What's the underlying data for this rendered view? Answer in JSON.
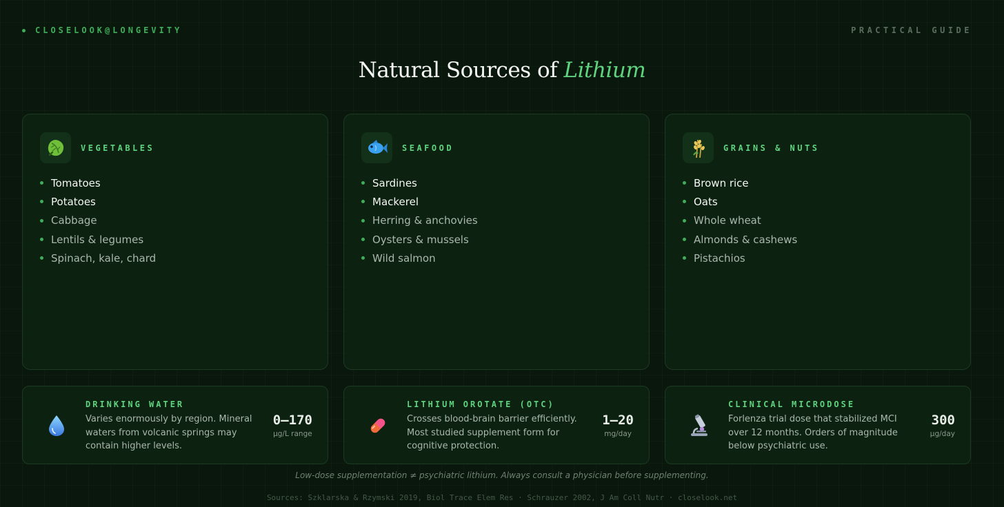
{
  "header": {
    "brand": "CLOSELOOK@LONGEVITY",
    "tag": "PRACTICAL GUIDE"
  },
  "title": {
    "prefix": "Natural Sources of",
    "accent": "Lithium"
  },
  "colors": {
    "accent": "#5fd37f",
    "background": "#0a170c",
    "card": "#0e2612"
  },
  "categories": [
    {
      "title": "VEGETABLES",
      "icon": "leafy-green-icon",
      "items": [
        "Tomatoes",
        "Potatoes",
        "Cabbage",
        "Lentils & legumes",
        "Spinach, kale, chard"
      ]
    },
    {
      "title": "SEAFOOD",
      "icon": "fish-icon",
      "items": [
        "Sardines",
        "Mackerel",
        "Herring & anchovies",
        "Oysters & mussels",
        "Wild salmon"
      ]
    },
    {
      "title": "GRAINS & NUTS",
      "icon": "wheat-icon",
      "items": [
        "Brown rice",
        "Oats",
        "Whole wheat",
        "Almonds & cashews",
        "Pistachios"
      ]
    }
  ],
  "info_cards": [
    {
      "title": "DRINKING WATER",
      "icon": "water-drop-icon",
      "description": "Varies enormously by region. Mineral waters from volcanic springs may contain higher levels.",
      "value": "0–170",
      "unit": "µg/L range"
    },
    {
      "title": "LITHIUM OROTATE (OTC)",
      "icon": "pill-icon",
      "description": "Crosses blood-brain barrier efficiently. Most studied supplement form for cognitive protection.",
      "value": "1–20",
      "unit": "mg/day"
    },
    {
      "title": "CLINICAL MICRODOSE",
      "icon": "microscope-icon",
      "description": "Forlenza trial dose that stabilized MCI over 12 months. Orders of magnitude below psychiatric use.",
      "value": "300",
      "unit": "µg/day"
    }
  ],
  "disclaimer": "Low-dose supplementation ≠ psychiatric lithium. Always consult a physician before supplementing.",
  "sources": "Sources: Szklarska & Rzymski 2019, Biol Trace Elem Res · Schrauzer 2002, J Am Coll Nutr · closelook.net"
}
